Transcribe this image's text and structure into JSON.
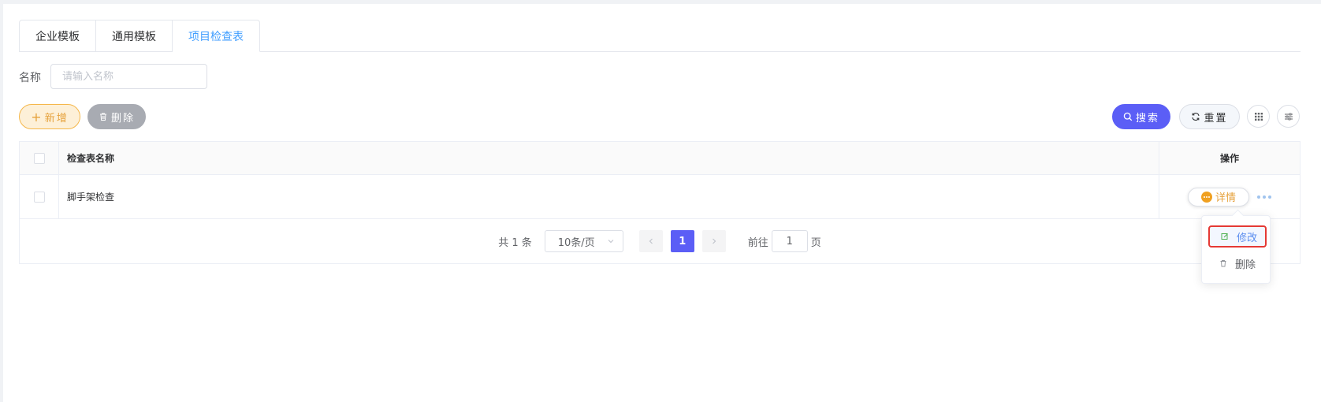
{
  "tabs": [
    {
      "label": "企业模板",
      "active": false
    },
    {
      "label": "通用模板",
      "active": false
    },
    {
      "label": "项目检查表",
      "active": true
    }
  ],
  "search_form": {
    "name_label": "名称",
    "name_placeholder": "请输入名称"
  },
  "toolbar": {
    "add_label": "新增",
    "delete_label": "删除",
    "search_label": "搜索",
    "reset_label": "重置"
  },
  "table": {
    "columns": [
      "检查表名称",
      "操作"
    ],
    "rows": [
      {
        "name": "脚手架检查",
        "detail_label": "详情"
      }
    ]
  },
  "pagination": {
    "total_text": "共 1 条",
    "page_size": "10条/页",
    "current_page": "1",
    "goto_prefix": "前往",
    "goto_value": "1",
    "goto_suffix": "页"
  },
  "dropdown": {
    "items": [
      {
        "label": "修改",
        "highlighted": true
      },
      {
        "label": "删除",
        "highlighted": false
      }
    ]
  },
  "colors": {
    "primary": "#5b5ef6",
    "tab_active": "#409eff",
    "warning": "#e6a23c",
    "highlight_border": "#e53935"
  }
}
